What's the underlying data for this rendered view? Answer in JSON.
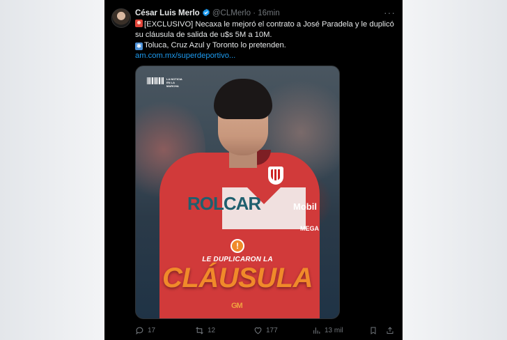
{
  "tweet": {
    "author_name": "César Luis Merlo",
    "handle": "@CLMerlo",
    "separator": "·",
    "time": "16min",
    "more_label": "···",
    "line1": "[EXCLUSIVO] Necaxa le mejoró el contrato a José Paradela y le duplicó su cláusula de salida de u$s 5M a 10M.",
    "line2": "Toluca, Cruz Azul y Toronto lo pretenden.",
    "link": "am.com.mx/superdeportivo...",
    "icons": {
      "verified": "verified-badge-icon",
      "siren": "siren-emoji",
      "snowflake": "snowflake-emoji"
    }
  },
  "media": {
    "logo_text": "LA NOTICIA EN LA MARCHA",
    "sponsor": "ROLCAR",
    "shirt_sponsor_right": "Mobil",
    "shirt_sponsor_lower": "MEGA",
    "caption_small": "LE DUPLICARON LA",
    "caption_big": "CLÁUSULA",
    "brand": "GM",
    "colors": {
      "accent": "#f08a2a",
      "shirt": "#d13a3a"
    }
  },
  "actions": {
    "replies": "17",
    "reposts": "12",
    "likes": "177",
    "views": "13 mil"
  }
}
